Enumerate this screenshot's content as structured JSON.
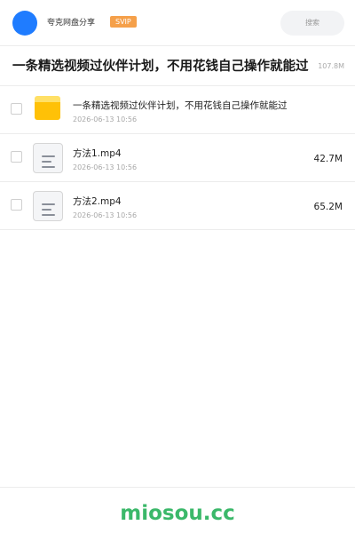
{
  "header": {
    "app_name": "夸克网盘分享",
    "badge": "SVIP",
    "search_placeholder": "搜索"
  },
  "share": {
    "title": "一条精选视频过伙伴计划，不用花钱自己操作就能过",
    "total_size": "107.8M"
  },
  "files": [
    {
      "type": "folder",
      "name": "一条精选视频过伙伴计划，不用花钱自己操作就能过",
      "date": "2026-06-13 10:56",
      "size": ""
    },
    {
      "type": "file",
      "name": "方法1.mp4",
      "date": "2026-06-13 10:56",
      "size": "42.7M"
    },
    {
      "type": "file",
      "name": "方法2.mp4",
      "date": "2026-06-13 10:56",
      "size": "65.2M"
    }
  ],
  "footer": {
    "brand": "miosou.cc"
  },
  "colors": {
    "avatar": "#1f7cff",
    "badge": "#f5a04a",
    "folder": "#ffc107",
    "brand": "#3bb86a"
  }
}
